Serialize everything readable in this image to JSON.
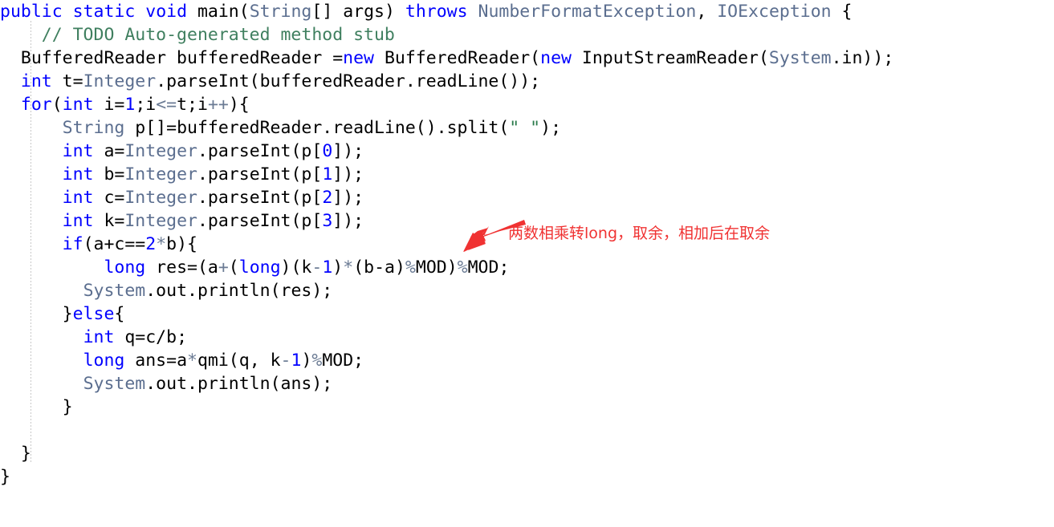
{
  "editor": {
    "language": "java",
    "background_color": "#ffffff",
    "indent_guide_color": "#c8c8c8"
  },
  "theme": {
    "keyword_color": "#0000ff",
    "type_color": "#5b6e8f",
    "number_color": "#0000ff",
    "operator_color": "#6b7b94",
    "string_color": "#2a7a4b",
    "comment_color": "#3f7f5f",
    "plain_color": "#000000",
    "annotation_color": "#f03232"
  },
  "code": {
    "lines": [
      {
        "indent": 0,
        "tokens": [
          {
            "t": "public",
            "c": "kw"
          },
          {
            "t": " ",
            "c": "pln"
          },
          {
            "t": "static",
            "c": "kw"
          },
          {
            "t": " ",
            "c": "pln"
          },
          {
            "t": "void",
            "c": "kw"
          },
          {
            "t": " main(",
            "c": "pln"
          },
          {
            "t": "String",
            "c": "typ"
          },
          {
            "t": "[] args) ",
            "c": "pln"
          },
          {
            "t": "throws",
            "c": "kw"
          },
          {
            "t": " ",
            "c": "pln"
          },
          {
            "t": "NumberFormatException",
            "c": "typ"
          },
          {
            "t": ", ",
            "c": "pln"
          },
          {
            "t": "IOException",
            "c": "typ"
          },
          {
            "t": " {",
            "c": "pln"
          }
        ]
      },
      {
        "indent": 0,
        "tokens": [
          {
            "t": "    // TODO Auto-generated method stub",
            "c": "cmt"
          }
        ]
      },
      {
        "indent": 0,
        "tokens": [
          {
            "t": "  ",
            "c": "pln"
          },
          {
            "t": "BufferedReader",
            "c": "pln"
          },
          {
            "t": " bufferedReader =",
            "c": "pln"
          },
          {
            "t": "new",
            "c": "kw"
          },
          {
            "t": " BufferedReader(",
            "c": "pln"
          },
          {
            "t": "new",
            "c": "kw"
          },
          {
            "t": " InputStreamReader(",
            "c": "pln"
          },
          {
            "t": "System",
            "c": "typ"
          },
          {
            "t": ".in));",
            "c": "pln"
          }
        ]
      },
      {
        "indent": 0,
        "tokens": [
          {
            "t": "  ",
            "c": "pln"
          },
          {
            "t": "int",
            "c": "kw"
          },
          {
            "t": " t=",
            "c": "pln"
          },
          {
            "t": "Integer",
            "c": "typ"
          },
          {
            "t": ".parseInt(bufferedReader.readLine());",
            "c": "pln"
          }
        ]
      },
      {
        "indent": 0,
        "tokens": [
          {
            "t": "  ",
            "c": "pln"
          },
          {
            "t": "for",
            "c": "kw"
          },
          {
            "t": "(",
            "c": "pln"
          },
          {
            "t": "int",
            "c": "kw"
          },
          {
            "t": " i=",
            "c": "pln"
          },
          {
            "t": "1",
            "c": "num"
          },
          {
            "t": ";i",
            "c": "pln"
          },
          {
            "t": "<=",
            "c": "op"
          },
          {
            "t": "t;i",
            "c": "pln"
          },
          {
            "t": "++",
            "c": "op"
          },
          {
            "t": "){",
            "c": "pln"
          }
        ]
      },
      {
        "indent": 0,
        "tokens": [
          {
            "t": "      ",
            "c": "pln"
          },
          {
            "t": "String",
            "c": "typ"
          },
          {
            "t": " p[]=bufferedReader.readLine().split(",
            "c": "pln"
          },
          {
            "t": "\" \"",
            "c": "str"
          },
          {
            "t": ");",
            "c": "pln"
          }
        ]
      },
      {
        "indent": 0,
        "tokens": [
          {
            "t": "      ",
            "c": "pln"
          },
          {
            "t": "int",
            "c": "kw"
          },
          {
            "t": " a=",
            "c": "pln"
          },
          {
            "t": "Integer",
            "c": "typ"
          },
          {
            "t": ".parseInt(p[",
            "c": "pln"
          },
          {
            "t": "0",
            "c": "num"
          },
          {
            "t": "]);",
            "c": "pln"
          }
        ]
      },
      {
        "indent": 0,
        "tokens": [
          {
            "t": "      ",
            "c": "pln"
          },
          {
            "t": "int",
            "c": "kw"
          },
          {
            "t": " b=",
            "c": "pln"
          },
          {
            "t": "Integer",
            "c": "typ"
          },
          {
            "t": ".parseInt(p[",
            "c": "pln"
          },
          {
            "t": "1",
            "c": "num"
          },
          {
            "t": "]);",
            "c": "pln"
          }
        ]
      },
      {
        "indent": 0,
        "tokens": [
          {
            "t": "      ",
            "c": "pln"
          },
          {
            "t": "int",
            "c": "kw"
          },
          {
            "t": " c=",
            "c": "pln"
          },
          {
            "t": "Integer",
            "c": "typ"
          },
          {
            "t": ".parseInt(p[",
            "c": "pln"
          },
          {
            "t": "2",
            "c": "num"
          },
          {
            "t": "]);",
            "c": "pln"
          }
        ]
      },
      {
        "indent": 0,
        "tokens": [
          {
            "t": "      ",
            "c": "pln"
          },
          {
            "t": "int",
            "c": "kw"
          },
          {
            "t": " k=",
            "c": "pln"
          },
          {
            "t": "Integer",
            "c": "typ"
          },
          {
            "t": ".parseInt(p[",
            "c": "pln"
          },
          {
            "t": "3",
            "c": "num"
          },
          {
            "t": "]);",
            "c": "pln"
          }
        ]
      },
      {
        "indent": 0,
        "tokens": [
          {
            "t": "      ",
            "c": "pln"
          },
          {
            "t": "if",
            "c": "kw"
          },
          {
            "t": "(a+c==",
            "c": "pln"
          },
          {
            "t": "2",
            "c": "num"
          },
          {
            "t": "*",
            "c": "op"
          },
          {
            "t": "b){",
            "c": "pln"
          }
        ]
      },
      {
        "indent": 0,
        "tokens": [
          {
            "t": "          ",
            "c": "pln"
          },
          {
            "t": "long",
            "c": "kw"
          },
          {
            "t": " res=(a",
            "c": "pln"
          },
          {
            "t": "+",
            "c": "op"
          },
          {
            "t": "(",
            "c": "pln"
          },
          {
            "t": "long",
            "c": "kw"
          },
          {
            "t": ")(k",
            "c": "pln"
          },
          {
            "t": "-",
            "c": "op"
          },
          {
            "t": "1",
            "c": "num"
          },
          {
            "t": ")",
            "c": "pln"
          },
          {
            "t": "*",
            "c": "op"
          },
          {
            "t": "(b-a)",
            "c": "pln"
          },
          {
            "t": "%",
            "c": "op"
          },
          {
            "t": "MOD)",
            "c": "pln"
          },
          {
            "t": "%",
            "c": "op"
          },
          {
            "t": "MOD;",
            "c": "pln"
          }
        ]
      },
      {
        "indent": 0,
        "tokens": [
          {
            "t": "        ",
            "c": "pln"
          },
          {
            "t": "System",
            "c": "typ"
          },
          {
            "t": ".out.println(res);",
            "c": "pln"
          }
        ]
      },
      {
        "indent": 0,
        "tokens": [
          {
            "t": "      }",
            "c": "pln"
          },
          {
            "t": "else",
            "c": "kw"
          },
          {
            "t": "{",
            "c": "pln"
          }
        ]
      },
      {
        "indent": 0,
        "tokens": [
          {
            "t": "        ",
            "c": "pln"
          },
          {
            "t": "int",
            "c": "kw"
          },
          {
            "t": " q=c/b;",
            "c": "pln"
          }
        ]
      },
      {
        "indent": 0,
        "tokens": [
          {
            "t": "        ",
            "c": "pln"
          },
          {
            "t": "long",
            "c": "kw"
          },
          {
            "t": " ans=a",
            "c": "pln"
          },
          {
            "t": "*",
            "c": "op"
          },
          {
            "t": "qmi(q, k",
            "c": "pln"
          },
          {
            "t": "-",
            "c": "op"
          },
          {
            "t": "1",
            "c": "num"
          },
          {
            "t": ")",
            "c": "pln"
          },
          {
            "t": "%",
            "c": "op"
          },
          {
            "t": "MOD;",
            "c": "pln"
          }
        ]
      },
      {
        "indent": 0,
        "tokens": [
          {
            "t": "        ",
            "c": "pln"
          },
          {
            "t": "System",
            "c": "typ"
          },
          {
            "t": ".out.println(ans);",
            "c": "pln"
          }
        ]
      },
      {
        "indent": 0,
        "tokens": [
          {
            "t": "      }",
            "c": "pln"
          }
        ]
      },
      {
        "indent": 0,
        "tokens": []
      },
      {
        "indent": 0,
        "tokens": [
          {
            "t": "  }",
            "c": "pln"
          }
        ]
      },
      {
        "indent": 0,
        "tokens": [
          {
            "t": "}",
            "c": "pln"
          }
        ]
      }
    ]
  },
  "annotation": {
    "text": "两数相乘转long，取余，相加后在取余",
    "color": "#f03232",
    "arrow": "arrow-pointing-down-left"
  }
}
